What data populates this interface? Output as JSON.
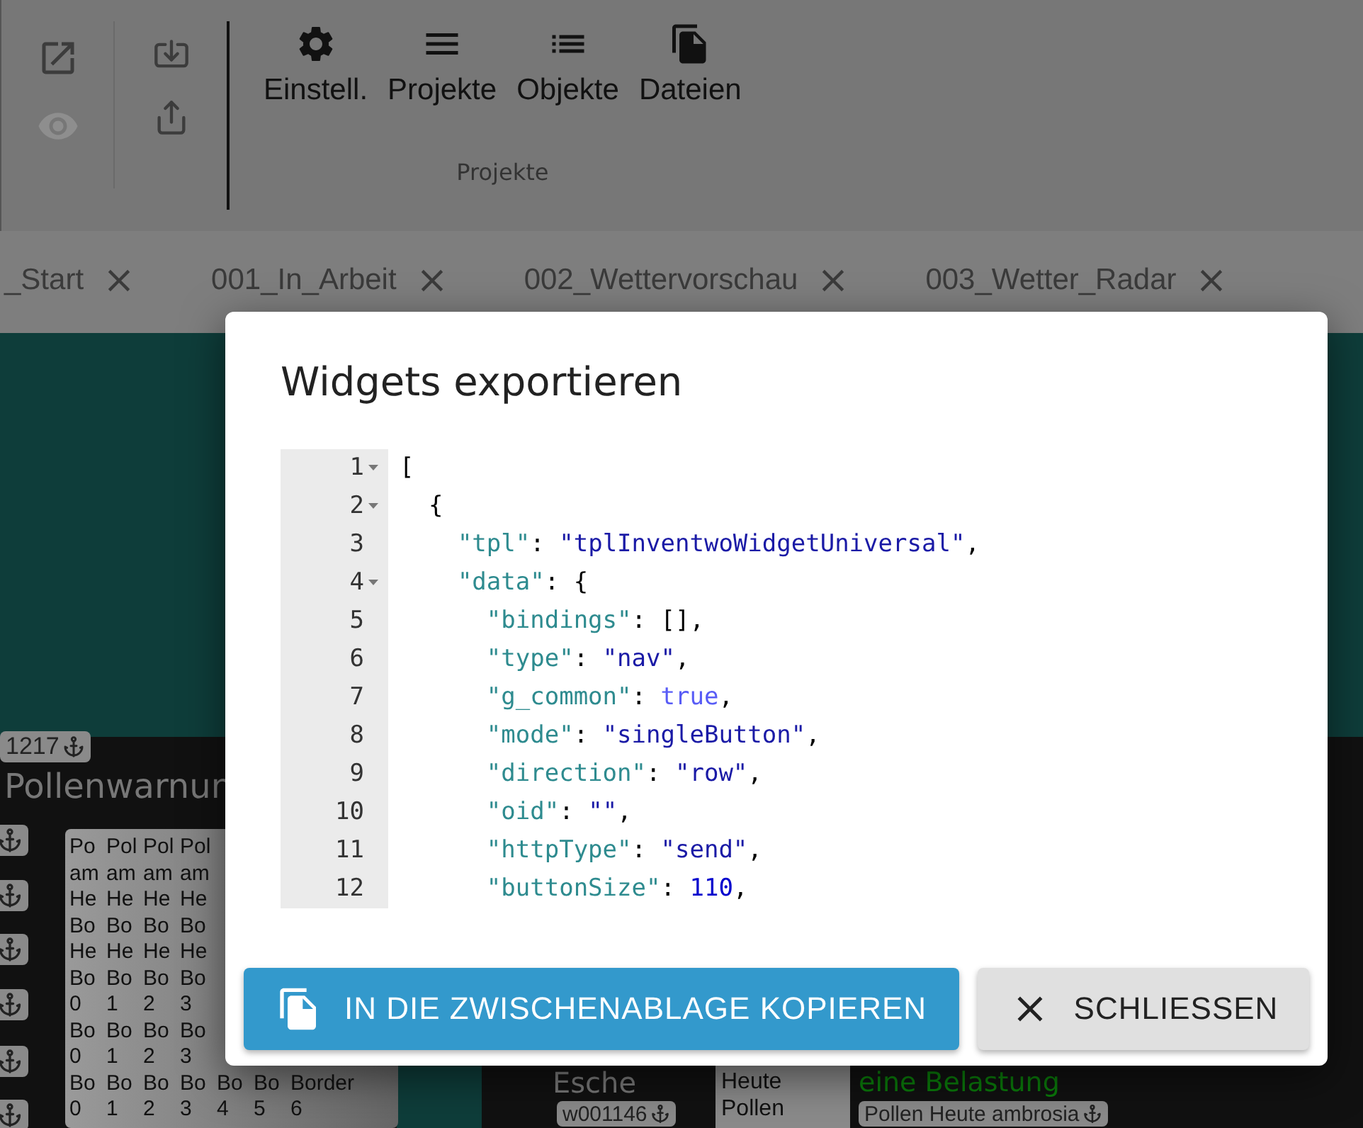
{
  "toolbar": {
    "tools": [
      {
        "kind": "open-external",
        "disabled": false
      },
      {
        "kind": "preview",
        "disabled": true
      },
      {
        "kind": "import",
        "disabled": false
      },
      {
        "kind": "export",
        "disabled": false
      }
    ],
    "buttons": [
      {
        "kind": "settings",
        "label": "Einstell."
      },
      {
        "kind": "menu",
        "label": "Projekte"
      },
      {
        "kind": "list",
        "label": "Objekte"
      },
      {
        "kind": "files",
        "label": "Dateien"
      }
    ],
    "group_label": "Projekte"
  },
  "tabs": [
    {
      "label": "_Start",
      "selected": false
    },
    {
      "label": "001_In_Arbeit",
      "selected": false
    },
    {
      "label": "002_Wettervorschau",
      "selected": false
    },
    {
      "label": "003_Wetter_Radar",
      "selected": false
    }
  ],
  "canvas": {
    "left_widget": {
      "id_label": "1217",
      "title": "Pollenwarnun",
      "grid_rows": [
        [
          "Po",
          "Pol",
          "Pol",
          "Pol"
        ],
        [
          "am",
          "am",
          "am",
          "am"
        ],
        [
          "He",
          "He",
          "He",
          "He"
        ],
        [
          "Bo",
          "Bo",
          "Bo",
          "Bo"
        ],
        [
          "He",
          "He",
          "He",
          "He"
        ],
        [
          "Bo",
          "Bo",
          "Bo",
          "Bo"
        ],
        [
          "0",
          "1",
          "2",
          "3"
        ],
        [
          "Bo",
          "Bo",
          "Bo",
          "Bo"
        ],
        [
          "0",
          "1",
          "2",
          "3"
        ],
        [
          "Bo",
          "Bo",
          "Bo",
          "Bo",
          "Bo",
          "Bo",
          "Border"
        ],
        [
          "0",
          "1",
          "2",
          "3",
          "4",
          "5",
          "6"
        ]
      ]
    },
    "right_widget": {
      "chip": "w001146",
      "title": "Esche",
      "box_lines": [
        "Heute",
        "Pollen"
      ],
      "value_chip": "Pollen Heute ambrosia",
      "status": "eine Belastung"
    }
  },
  "dialog": {
    "title": "Widgets exportieren",
    "code_lines": [
      {
        "number": "1",
        "fold": true,
        "tokens": [
          {
            "kind": "punct",
            "text": "["
          }
        ]
      },
      {
        "number": "2",
        "fold": true,
        "tokens": [
          {
            "kind": "punct",
            "text": "  {"
          }
        ]
      },
      {
        "number": "3",
        "fold": false,
        "tokens": [
          {
            "kind": "key",
            "text": "    \"tpl\""
          },
          {
            "kind": "punct",
            "text": ": "
          },
          {
            "kind": "string",
            "text": "\"tplInventwoWidgetUniversal\""
          },
          {
            "kind": "punct",
            "text": ","
          }
        ]
      },
      {
        "number": "4",
        "fold": true,
        "tokens": [
          {
            "kind": "key",
            "text": "    \"data\""
          },
          {
            "kind": "punct",
            "text": ": {"
          }
        ]
      },
      {
        "number": "5",
        "fold": false,
        "tokens": [
          {
            "kind": "key",
            "text": "      \"bindings\""
          },
          {
            "kind": "punct",
            "text": ": [],"
          }
        ]
      },
      {
        "number": "6",
        "fold": false,
        "tokens": [
          {
            "kind": "key",
            "text": "      \"type\""
          },
          {
            "kind": "punct",
            "text": ": "
          },
          {
            "kind": "string",
            "text": "\"nav\""
          },
          {
            "kind": "punct",
            "text": ","
          }
        ]
      },
      {
        "number": "7",
        "fold": false,
        "tokens": [
          {
            "kind": "key",
            "text": "      \"g_common\""
          },
          {
            "kind": "punct",
            "text": ": "
          },
          {
            "kind": "bool",
            "text": "true"
          },
          {
            "kind": "punct",
            "text": ","
          }
        ]
      },
      {
        "number": "8",
        "fold": false,
        "tokens": [
          {
            "kind": "key",
            "text": "      \"mode\""
          },
          {
            "kind": "punct",
            "text": ": "
          },
          {
            "kind": "string",
            "text": "\"singleButton\""
          },
          {
            "kind": "punct",
            "text": ","
          }
        ]
      },
      {
        "number": "9",
        "fold": false,
        "tokens": [
          {
            "kind": "key",
            "text": "      \"direction\""
          },
          {
            "kind": "punct",
            "text": ": "
          },
          {
            "kind": "string",
            "text": "\"row\""
          },
          {
            "kind": "punct",
            "text": ","
          }
        ]
      },
      {
        "number": "10",
        "fold": false,
        "tokens": [
          {
            "kind": "key",
            "text": "      \"oid\""
          },
          {
            "kind": "punct",
            "text": ": "
          },
          {
            "kind": "string",
            "text": "\"\""
          },
          {
            "kind": "punct",
            "text": ","
          }
        ]
      },
      {
        "number": "11",
        "fold": false,
        "tokens": [
          {
            "kind": "key",
            "text": "      \"httpType\""
          },
          {
            "kind": "punct",
            "text": ": "
          },
          {
            "kind": "string",
            "text": "\"send\""
          },
          {
            "kind": "punct",
            "text": ","
          }
        ]
      },
      {
        "number": "12",
        "fold": false,
        "tokens": [
          {
            "kind": "key",
            "text": "      \"buttonSize\""
          },
          {
            "kind": "punct",
            "text": ": "
          },
          {
            "kind": "number",
            "text": "110"
          },
          {
            "kind": "punct",
            "text": ","
          }
        ]
      }
    ],
    "buttons": [
      {
        "kind": "primary",
        "label": "IN DIE ZWISCHENABLAGE KOPIEREN"
      },
      {
        "kind": "secondary",
        "label": "SCHLIESSEN"
      }
    ]
  }
}
